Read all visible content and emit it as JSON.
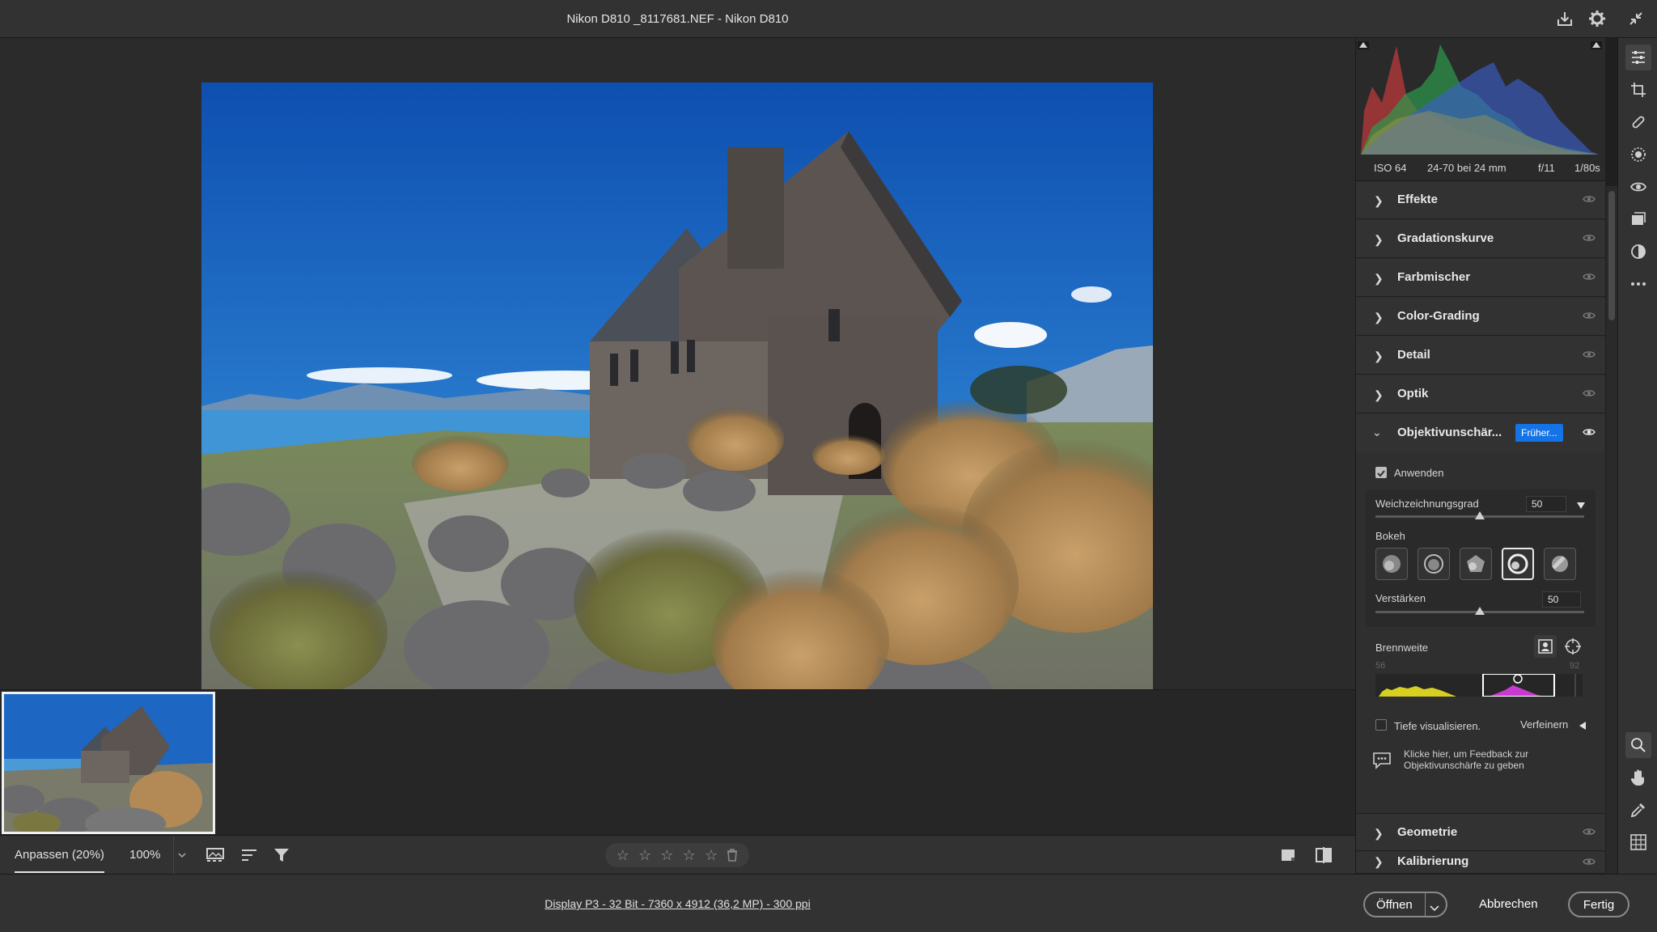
{
  "window": {
    "title": "Nikon D810 _8117681.NEF - Nikon D810"
  },
  "histogram": {
    "exif": {
      "iso": "ISO 64",
      "lens": "24-70 bei 24 mm",
      "aperture": "f/11",
      "shutter": "1/80s"
    }
  },
  "panel": {
    "sections_top": [
      {
        "label": "Effekte"
      },
      {
        "label": "Gradationskurve"
      },
      {
        "label": "Farbmischer"
      },
      {
        "label": "Color-Grading"
      },
      {
        "label": "Detail"
      },
      {
        "label": "Optik"
      }
    ],
    "lens_blur": {
      "label": "Objektivunschär...",
      "early_access_badge": "Früher...",
      "apply_label": "Anwenden",
      "apply_checked": true,
      "blur_amount_label": "Weichzeichnungsgrad",
      "blur_amount_value": "50",
      "bokeh_label": "Bokeh",
      "bokeh_selected_index": 3,
      "boost_label": "Verstärken",
      "boost_value": "50",
      "focal_range_label": "Brennweite",
      "focal_range_min": "56",
      "focal_range_max": "92",
      "visualize_depth_label": "Tiefe visualisieren.",
      "visualize_depth_checked": false,
      "refine_label": "Verfeinern",
      "feedback_text_1": "Klicke hier, um Feedback zur",
      "feedback_text_2": "Objektivunschärfe zu geben"
    },
    "sections_bottom": [
      {
        "label": "Geometrie"
      },
      {
        "label": "Kalibrierung"
      }
    ]
  },
  "toolbar": {
    "fit_label": "Anpassen (20%)",
    "zoom_label": "100%",
    "stars": [
      "☆",
      "☆",
      "☆",
      "☆",
      "☆"
    ]
  },
  "statusbar": {
    "doc_info": "Display P3 - 32 Bit - 7360 x 4912 (36,2 MP) - 300 ppi",
    "open_label": "Öffnen",
    "cancel_label": "Abbrechen",
    "done_label": "Fertig"
  },
  "colors": {
    "accent": "#1473e6",
    "panel": "#2f2f2f",
    "chrome": "#323232"
  }
}
